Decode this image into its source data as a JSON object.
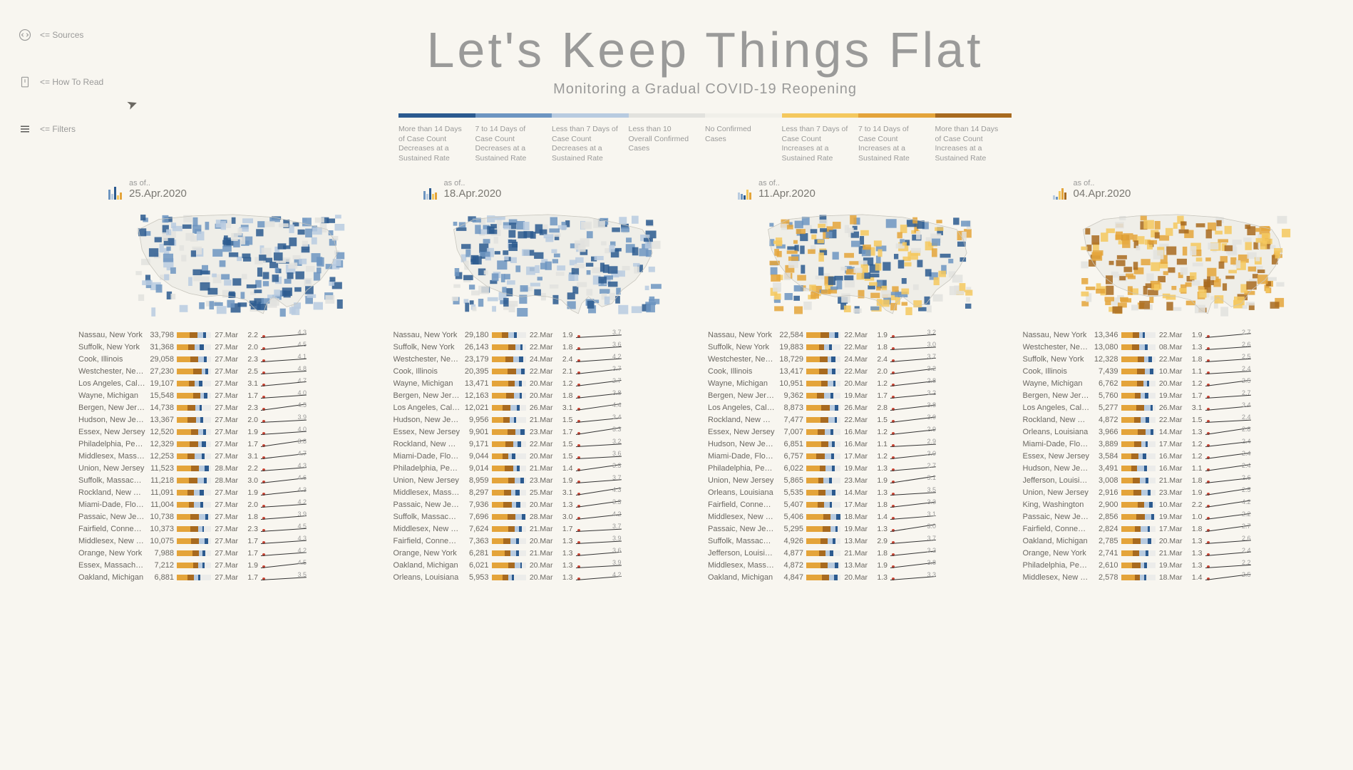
{
  "sidebar": {
    "sources": "<= Sources",
    "howto": "<= How To Read",
    "filters": "<= Filters"
  },
  "header": {
    "title": "Let's Keep Things Flat",
    "subtitle": "Monitoring a Gradual COVID-19 Reopening"
  },
  "legend": [
    {
      "color": "#2b5a8f",
      "label": "More than 14 Days of Case Count Decreases at a Sustained Rate"
    },
    {
      "color": "#6d95c1",
      "label": "7 to 14 Days of Case Count Decreases at a Sustained Rate"
    },
    {
      "color": "#b8cbe0",
      "label": "Less than 7 Days of Case Count Decreases at a Sustained Rate"
    },
    {
      "color": "#e2e2de",
      "label": "Less than 10 Overall Confirmed Cases"
    },
    {
      "color": "#f0efe9",
      "label": "No Confirmed Cases"
    },
    {
      "color": "#f4c85e",
      "label": "Less than 7 Days of Case Count Increases at a Sustained Rate"
    },
    {
      "color": "#e4a43a",
      "label": "7 to 14 Days of Case Count Increases at a Sustained Rate"
    },
    {
      "color": "#a86a1f",
      "label": "More than 14 Days of Case Count Increases at a Sustained Rate"
    }
  ],
  "chart_data": {
    "type": "table",
    "panels": [
      {
        "asof_label": "as of..",
        "asof": "25.Apr.2020",
        "spark": [
          {
            "h": 14,
            "c": "#6d95c1"
          },
          {
            "h": 8,
            "c": "#b8cbe0"
          },
          {
            "h": 18,
            "c": "#2b5a8f"
          },
          {
            "h": 6,
            "c": "#f4c85e"
          },
          {
            "h": 10,
            "c": "#e4a43a"
          }
        ],
        "map_tint": "blue",
        "rows": [
          {
            "county": "Nassau, New York",
            "cases": "33,798",
            "date": "27.Mar",
            "v": "2.2",
            "m": "4.3"
          },
          {
            "county": "Suffolk, New York",
            "cases": "31,368",
            "date": "27.Mar",
            "v": "2.0",
            "m": "4.5"
          },
          {
            "county": "Cook, Illinois",
            "cases": "29,058",
            "date": "27.Mar",
            "v": "2.3",
            "m": "4.1"
          },
          {
            "county": "Westchester, New Yo..",
            "cases": "27,230",
            "date": "27.Mar",
            "v": "2.5",
            "m": "4.8"
          },
          {
            "county": "Los Angeles, Califor..",
            "cases": "19,107",
            "date": "27.Mar",
            "v": "3.1",
            "m": "4.7"
          },
          {
            "county": "Wayne, Michigan",
            "cases": "15,548",
            "date": "27.Mar",
            "v": "1.7",
            "m": "4.0"
          },
          {
            "county": "Bergen, New Jersey",
            "cases": "14,738",
            "date": "27.Mar",
            "v": "2.3",
            "m": "4.5"
          },
          {
            "county": "Hudson, New Jersey",
            "cases": "13,367",
            "date": "27.Mar",
            "v": "2.0",
            "m": "3.9"
          },
          {
            "county": "Essex, New Jersey",
            "cases": "12,520",
            "date": "27.Mar",
            "v": "1.9",
            "m": "4.0"
          },
          {
            "county": "Philadelphia, Pennsyl..",
            "cases": "12,329",
            "date": "27.Mar",
            "v": "1.7",
            "m": "3.8"
          },
          {
            "county": "Middlesex, Massachu..",
            "cases": "12,253",
            "date": "27.Mar",
            "v": "3.1",
            "m": "4.7"
          },
          {
            "county": "Union, New Jersey",
            "cases": "11,523",
            "date": "28.Mar",
            "v": "2.2",
            "m": "4.3"
          },
          {
            "county": "Suffolk, Massachusetts",
            "cases": "11,218",
            "date": "28.Mar",
            "v": "3.0",
            "m": "4.6"
          },
          {
            "county": "Rockland, New York",
            "cases": "11,091",
            "date": "27.Mar",
            "v": "1.9",
            "m": "4.3"
          },
          {
            "county": "Miami-Dade, Florida",
            "cases": "11,004",
            "date": "27.Mar",
            "v": "2.0",
            "m": "4.2"
          },
          {
            "county": "Passaic, New Jersey",
            "cases": "10,738",
            "date": "27.Mar",
            "v": "1.8",
            "m": "3.9"
          },
          {
            "county": "Fairfield, Connecticut",
            "cases": "10,373",
            "date": "27.Mar",
            "v": "2.3",
            "m": "4.5"
          },
          {
            "county": "Middlesex, New Jers..",
            "cases": "10,075",
            "date": "27.Mar",
            "v": "1.7",
            "m": "4.3"
          },
          {
            "county": "Orange, New York",
            "cases": "7,988",
            "date": "27.Mar",
            "v": "1.7",
            "m": "4.2"
          },
          {
            "county": "Essex, Massachusetts",
            "cases": "7,212",
            "date": "27.Mar",
            "v": "1.9",
            "m": "4.5"
          },
          {
            "county": "Oakland, Michigan",
            "cases": "6,881",
            "date": "27.Mar",
            "v": "1.7",
            "m": "3.5"
          }
        ]
      },
      {
        "asof_label": "as of..",
        "asof": "18.Apr.2020",
        "spark": [
          {
            "h": 12,
            "c": "#6d95c1"
          },
          {
            "h": 8,
            "c": "#b8cbe0"
          },
          {
            "h": 16,
            "c": "#2b5a8f"
          },
          {
            "h": 8,
            "c": "#f4c85e"
          },
          {
            "h": 10,
            "c": "#e4a43a"
          }
        ],
        "map_tint": "blue",
        "rows": [
          {
            "county": "Nassau, New York",
            "cases": "29,180",
            "date": "22.Mar",
            "v": "1.9",
            "m": "3.7"
          },
          {
            "county": "Suffolk, New York",
            "cases": "26,143",
            "date": "22.Mar",
            "v": "1.8",
            "m": "3.6"
          },
          {
            "county": "Westchester, New Yo..",
            "cases": "23,179",
            "date": "24.Mar",
            "v": "2.4",
            "m": "4.2"
          },
          {
            "county": "Cook, Illinois",
            "cases": "20,395",
            "date": "22.Mar",
            "v": "2.1",
            "m": "3.7"
          },
          {
            "county": "Wayne, Michigan",
            "cases": "13,471",
            "date": "20.Mar",
            "v": "1.2",
            "m": "2.7"
          },
          {
            "county": "Bergen, New Jersey",
            "cases": "12,163",
            "date": "20.Mar",
            "v": "1.8",
            "m": "3.8"
          },
          {
            "county": "Los Angeles, Califor..",
            "cases": "12,021",
            "date": "26.Mar",
            "v": "3.1",
            "m": "4.4"
          },
          {
            "county": "Hudson, New Jersey",
            "cases": "9,956",
            "date": "21.Mar",
            "v": "1.5",
            "m": "3.4"
          },
          {
            "county": "Essex, New Jersey",
            "cases": "9,901",
            "date": "23.Mar",
            "v": "1.7",
            "m": "3.3"
          },
          {
            "county": "Rockland, New York",
            "cases": "9,171",
            "date": "22.Mar",
            "v": "1.5",
            "m": "3.2"
          },
          {
            "county": "Miami-Dade, Florida",
            "cases": "9,044",
            "date": "20.Mar",
            "v": "1.5",
            "m": "3.6"
          },
          {
            "county": "Philadelphia, Pennsyl..",
            "cases": "9,014",
            "date": "21.Mar",
            "v": "1.4",
            "m": "3.3"
          },
          {
            "county": "Union, New Jersey",
            "cases": "8,959",
            "date": "23.Mar",
            "v": "1.9",
            "m": "3.7"
          },
          {
            "county": "Middlesex, Massachu..",
            "cases": "8,297",
            "date": "25.Mar",
            "v": "3.1",
            "m": "4.3"
          },
          {
            "county": "Passaic, New Jersey",
            "cases": "7,936",
            "date": "20.Mar",
            "v": "1.3",
            "m": "3.3"
          },
          {
            "county": "Suffolk, Massachusetts",
            "cases": "7,696",
            "date": "28.Mar",
            "v": "3.0",
            "m": "4.2"
          },
          {
            "county": "Middlesex, New Jers..",
            "cases": "7,624",
            "date": "21.Mar",
            "v": "1.7",
            "m": "3.7"
          },
          {
            "county": "Fairfield, Connecticut",
            "cases": "7,363",
            "date": "20.Mar",
            "v": "1.3",
            "m": "3.9"
          },
          {
            "county": "Orange, New York",
            "cases": "6,281",
            "date": "21.Mar",
            "v": "1.3",
            "m": "3.6"
          },
          {
            "county": "Oakland, Michigan",
            "cases": "6,021",
            "date": "20.Mar",
            "v": "1.3",
            "m": "3.9"
          },
          {
            "county": "Orleans, Louisiana",
            "cases": "5,953",
            "date": "20.Mar",
            "v": "1.3",
            "m": "4.2"
          }
        ]
      },
      {
        "asof_label": "as of..",
        "asof": "11.Apr.2020",
        "spark": [
          {
            "h": 10,
            "c": "#b8cbe0"
          },
          {
            "h": 8,
            "c": "#6d95c1"
          },
          {
            "h": 6,
            "c": "#2b5a8f"
          },
          {
            "h": 14,
            "c": "#f4c85e"
          },
          {
            "h": 10,
            "c": "#e4a43a"
          }
        ],
        "map_tint": "mix",
        "rows": [
          {
            "county": "Nassau, New York",
            "cases": "22,584",
            "date": "22.Mar",
            "v": "1.9",
            "m": "3.2"
          },
          {
            "county": "Suffolk, New York",
            "cases": "19,883",
            "date": "22.Mar",
            "v": "1.8",
            "m": "3.0"
          },
          {
            "county": "Westchester, New Yo..",
            "cases": "18,729",
            "date": "24.Mar",
            "v": "2.4",
            "m": "3.7"
          },
          {
            "county": "Cook, Illinois",
            "cases": "13,417",
            "date": "22.Mar",
            "v": "2.0",
            "m": "3.2"
          },
          {
            "county": "Wayne, Michigan",
            "cases": "10,951",
            "date": "20.Mar",
            "v": "1.2",
            "m": "2.8"
          },
          {
            "county": "Bergen, New Jersey",
            "cases": "9,362",
            "date": "19.Mar",
            "v": "1.7",
            "m": "3.2"
          },
          {
            "county": "Los Angeles, Califor..",
            "cases": "8,873",
            "date": "26.Mar",
            "v": "2.8",
            "m": "3.8"
          },
          {
            "county": "Rockland, New York",
            "cases": "7,477",
            "date": "22.Mar",
            "v": "1.5",
            "m": "3.0"
          },
          {
            "county": "Essex, New Jersey",
            "cases": "7,007",
            "date": "16.Mar",
            "v": "1.2",
            "m": "2.9"
          },
          {
            "county": "Hudson, New Jersey",
            "cases": "6,851",
            "date": "16.Mar",
            "v": "1.1",
            "m": "2.9"
          },
          {
            "county": "Miami-Dade, Florida",
            "cases": "6,757",
            "date": "17.Mar",
            "v": "1.2",
            "m": "3.0"
          },
          {
            "county": "Philadelphia, Pennsyl..",
            "cases": "6,022",
            "date": "19.Mar",
            "v": "1.3",
            "m": "2.7"
          },
          {
            "county": "Union, New Jersey",
            "cases": "5,865",
            "date": "23.Mar",
            "v": "1.9",
            "m": "3.1"
          },
          {
            "county": "Orleans, Louisiana",
            "cases": "5,535",
            "date": "14.Mar",
            "v": "1.3",
            "m": "3.5"
          },
          {
            "county": "Fairfield, Connecticut",
            "cases": "5,407",
            "date": "17.Mar",
            "v": "1.8",
            "m": "3.3"
          },
          {
            "county": "Middlesex, New Jers..",
            "cases": "5,406",
            "date": "18.Mar",
            "v": "1.4",
            "m": "3.1"
          },
          {
            "county": "Passaic, New Jersey",
            "cases": "5,295",
            "date": "19.Mar",
            "v": "1.3",
            "m": "3.0"
          },
          {
            "county": "Suffolk, Massachusetts",
            "cases": "4,926",
            "date": "13.Mar",
            "v": "2.9",
            "m": "3.7"
          },
          {
            "county": "Jefferson, Louisiana",
            "cases": "4,877",
            "date": "21.Mar",
            "v": "1.8",
            "m": "3.2"
          },
          {
            "county": "Middlesex, Massachu..",
            "cases": "4,872",
            "date": "13.Mar",
            "v": "1.9",
            "m": "3.8"
          },
          {
            "county": "Oakland, Michigan",
            "cases": "4,847",
            "date": "20.Mar",
            "v": "1.3",
            "m": "3.3"
          }
        ]
      },
      {
        "asof_label": "as of..",
        "asof": "04.Apr.2020",
        "spark": [
          {
            "h": 6,
            "c": "#b8cbe0"
          },
          {
            "h": 4,
            "c": "#6d95c1"
          },
          {
            "h": 12,
            "c": "#f4c85e"
          },
          {
            "h": 16,
            "c": "#e4a43a"
          },
          {
            "h": 10,
            "c": "#a86a1f"
          }
        ],
        "map_tint": "yellow",
        "rows": [
          {
            "county": "Nassau, New York",
            "cases": "13,346",
            "date": "22.Mar",
            "v": "1.9",
            "m": "2.7"
          },
          {
            "county": "Westchester, New Yo..",
            "cases": "13,080",
            "date": "08.Mar",
            "v": "1.3",
            "m": "2.6"
          },
          {
            "county": "Suffolk, New York",
            "cases": "12,328",
            "date": "22.Mar",
            "v": "1.8",
            "m": "2.5"
          },
          {
            "county": "Cook, Illinois",
            "cases": "7,439",
            "date": "10.Mar",
            "v": "1.1",
            "m": "2.4"
          },
          {
            "county": "Wayne, Michigan",
            "cases": "6,762",
            "date": "20.Mar",
            "v": "1.2",
            "m": "2.5"
          },
          {
            "county": "Bergen, New Jersey",
            "cases": "5,760",
            "date": "19.Mar",
            "v": "1.7",
            "m": "2.7"
          },
          {
            "county": "Los Angeles, Califor..",
            "cases": "5,277",
            "date": "26.Mar",
            "v": "3.1",
            "m": "3.4"
          },
          {
            "county": "Rockland, New York",
            "cases": "4,872",
            "date": "22.Mar",
            "v": "1.5",
            "m": "2.4"
          },
          {
            "county": "Orleans, Louisiana",
            "cases": "3,966",
            "date": "14.Mar",
            "v": "1.3",
            "m": "2.8"
          },
          {
            "county": "Miami-Dade, Florida",
            "cases": "3,889",
            "date": "17.Mar",
            "v": "1.2",
            "m": "2.4"
          },
          {
            "county": "Essex, New Jersey",
            "cases": "3,584",
            "date": "16.Mar",
            "v": "1.2",
            "m": "2.4"
          },
          {
            "county": "Hudson, New Jersey",
            "cases": "3,491",
            "date": "16.Mar",
            "v": "1.1",
            "m": "2.4"
          },
          {
            "county": "Jefferson, Louisiana",
            "cases": "3,008",
            "date": "21.Mar",
            "v": "1.8",
            "m": "2.6"
          },
          {
            "county": "Union, New Jersey",
            "cases": "2,916",
            "date": "23.Mar",
            "v": "1.9",
            "m": "2.5"
          },
          {
            "county": "King, Washington",
            "cases": "2,900",
            "date": "10.Mar",
            "v": "2.2",
            "m": "4.2"
          },
          {
            "county": "Passaic, New Jersey",
            "cases": "2,856",
            "date": "19.Mar",
            "v": "1.0",
            "m": "2.2"
          },
          {
            "county": "Fairfield, Connecticut",
            "cases": "2,824",
            "date": "17.Mar",
            "v": "1.8",
            "m": "2.7"
          },
          {
            "county": "Oakland, Michigan",
            "cases": "2,785",
            "date": "20.Mar",
            "v": "1.3",
            "m": "2.6"
          },
          {
            "county": "Orange, New York",
            "cases": "2,741",
            "date": "21.Mar",
            "v": "1.3",
            "m": "2.4"
          },
          {
            "county": "Philadelphia, Pennsyl..",
            "cases": "2,610",
            "date": "19.Mar",
            "v": "1.3",
            "m": "2.2"
          },
          {
            "county": "Middlesex, New Jers..",
            "cases": "2,578",
            "date": "18.Mar",
            "v": "1.4",
            "m": "2.5"
          }
        ]
      }
    ]
  }
}
